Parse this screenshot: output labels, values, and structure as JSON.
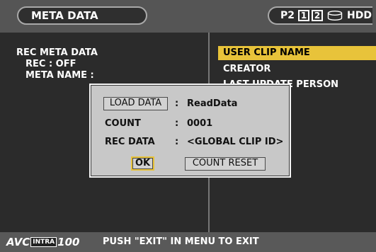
{
  "header": {
    "title": "META DATA",
    "status": {
      "p2_label": "P2",
      "slot_1": "1",
      "slot_2": "2",
      "hdd_label": "HDD",
      "hdd_icon": "hdd-drum-icon"
    }
  },
  "left_panel": {
    "line_1": "REC META DATA",
    "line_2": "REC : OFF",
    "line_3": "META NAME :"
  },
  "menu": {
    "items": [
      {
        "label": "USER CLIP NAME",
        "selected": true
      },
      {
        "label": "CREATOR",
        "selected": false
      },
      {
        "label": "LAST UPDATE PERSON",
        "selected": false
      }
    ]
  },
  "dialog": {
    "load_button": "LOAD DATA",
    "load_value": "ReadData",
    "count_label": "COUNT",
    "count_value": "0001",
    "rec_data_label": "REC DATA",
    "rec_data_value": "<GLOBAL CLIP ID>",
    "separator": ":",
    "ok_button": "OK",
    "count_reset_button": "COUNT RESET"
  },
  "footer": {
    "logo_avc": "AVC",
    "logo_intra": "INTRA",
    "logo_num": "100",
    "message": "PUSH \"EXIT\" IN MENU TO EXIT"
  },
  "colors": {
    "highlight": "#e8c33a",
    "background": "#2b2b2b",
    "header_bg": "#555555",
    "dialog_bg": "#c8c8c8"
  }
}
